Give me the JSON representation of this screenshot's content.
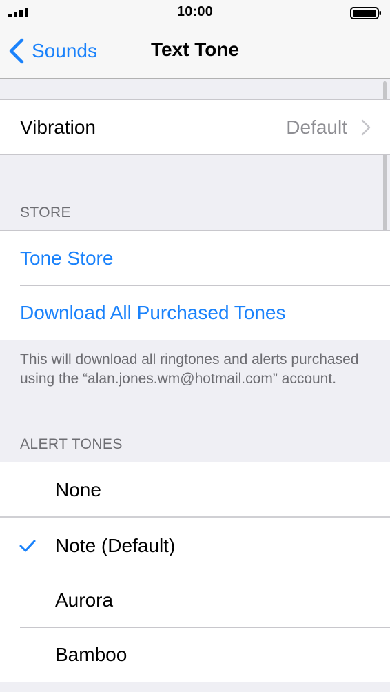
{
  "status_bar": {
    "time": "10:00",
    "signal_icon": "cellular-signal-icon",
    "battery_icon": "battery-full-icon"
  },
  "nav": {
    "back_label": "Sounds",
    "title": "Text Tone",
    "accent_color": "#1a82fb"
  },
  "vibration": {
    "label": "Vibration",
    "value": "Default"
  },
  "store": {
    "header": "STORE",
    "tone_store": "Tone Store",
    "download_all": "Download All Purchased Tones",
    "footer": "This will download all ringtones and alerts purchased using the “alan.jones.wm@hotmail.com” account."
  },
  "alert_tones": {
    "header": "ALERT TONES",
    "none_label": "None",
    "items": [
      {
        "label": "Note (Default)",
        "selected": true
      },
      {
        "label": "Aurora",
        "selected": false
      },
      {
        "label": "Bamboo",
        "selected": false
      }
    ]
  }
}
